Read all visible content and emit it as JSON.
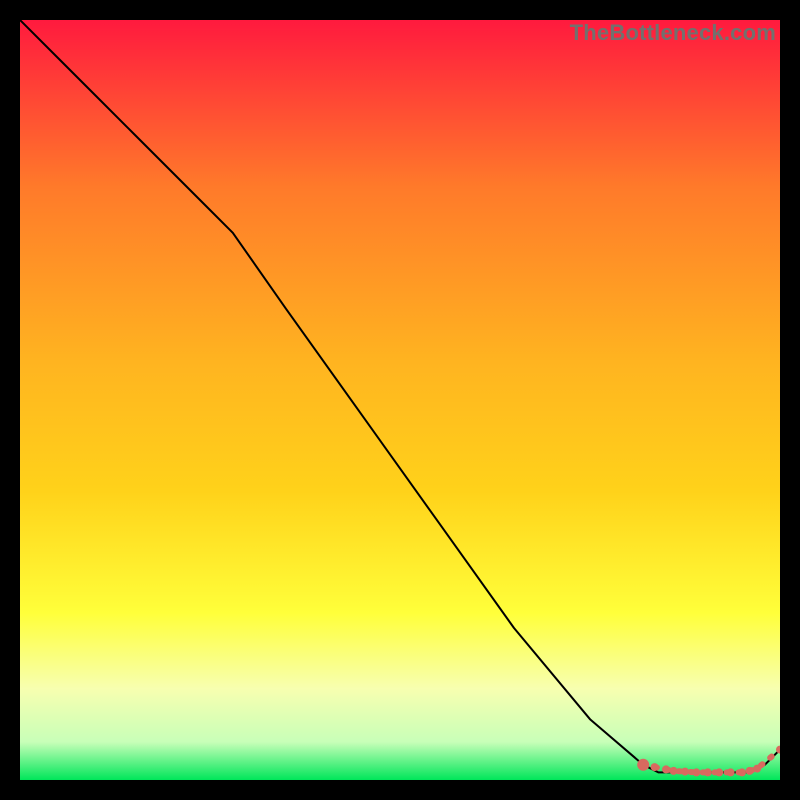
{
  "watermark": "TheBottleneck.com",
  "colors": {
    "background": "#000000",
    "gradient_top": "#ff1a3e",
    "gradient_mid_upper": "#ff7a2a",
    "gradient_mid": "#ffd21a",
    "gradient_mid_lower": "#ffff3a",
    "gradient_lower": "#f7ffb0",
    "gradient_bottom": "#00e65a",
    "line": "#000000",
    "marker": "#d86a5f"
  },
  "chart_data": {
    "type": "line",
    "title": "",
    "xlabel": "",
    "ylabel": "",
    "xlim": [
      0,
      100
    ],
    "ylim": [
      0,
      100
    ],
    "series": [
      {
        "name": "curve",
        "x": [
          0,
          5,
          10,
          15,
          20,
          25,
          28,
          35,
          45,
          55,
          65,
          75,
          82,
          84,
          86,
          88,
          90,
          92,
          94,
          96,
          98,
          100
        ],
        "y": [
          100,
          95,
          90,
          85,
          80,
          75,
          72,
          62,
          48,
          34,
          20,
          8,
          2,
          1,
          1,
          1,
          1,
          1,
          1,
          1,
          2,
          4
        ]
      }
    ],
    "markers": {
      "name": "highlight-points",
      "x": [
        82,
        83.5,
        85,
        86,
        87.5,
        89,
        90.5,
        92,
        93.5,
        95,
        96,
        97,
        100
      ],
      "y": [
        2,
        1.7,
        1.4,
        1.2,
        1.1,
        1.0,
        1.0,
        1.0,
        1.0,
        1.0,
        1.2,
        1.5,
        4
      ]
    }
  }
}
